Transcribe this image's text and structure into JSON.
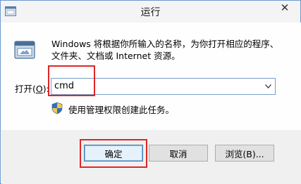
{
  "window": {
    "title": "运行",
    "close_glyph": "✕"
  },
  "dialog": {
    "description_line1": "Windows 将根据你所输入的名称，为你打开相应的程序、",
    "description_line2": "文件夹、文档或 Internet 资源。",
    "open_label_prefix": "打开(",
    "open_label_hotkey": "O",
    "open_label_suffix": "):",
    "input_value": "cmd",
    "admin_note": "使用管理权限创建此任务。"
  },
  "buttons": {
    "ok": "确定",
    "cancel": "取消",
    "browse": "浏览(B)..."
  },
  "icons": {
    "title_icon": "run-window-icon",
    "run_icon": "run-app-icon",
    "shield_icon": "uac-shield-icon",
    "dropdown_icon": "chevron-down-icon"
  },
  "colors": {
    "highlight_border": "#e02626",
    "window_border": "#6b9bd1"
  }
}
